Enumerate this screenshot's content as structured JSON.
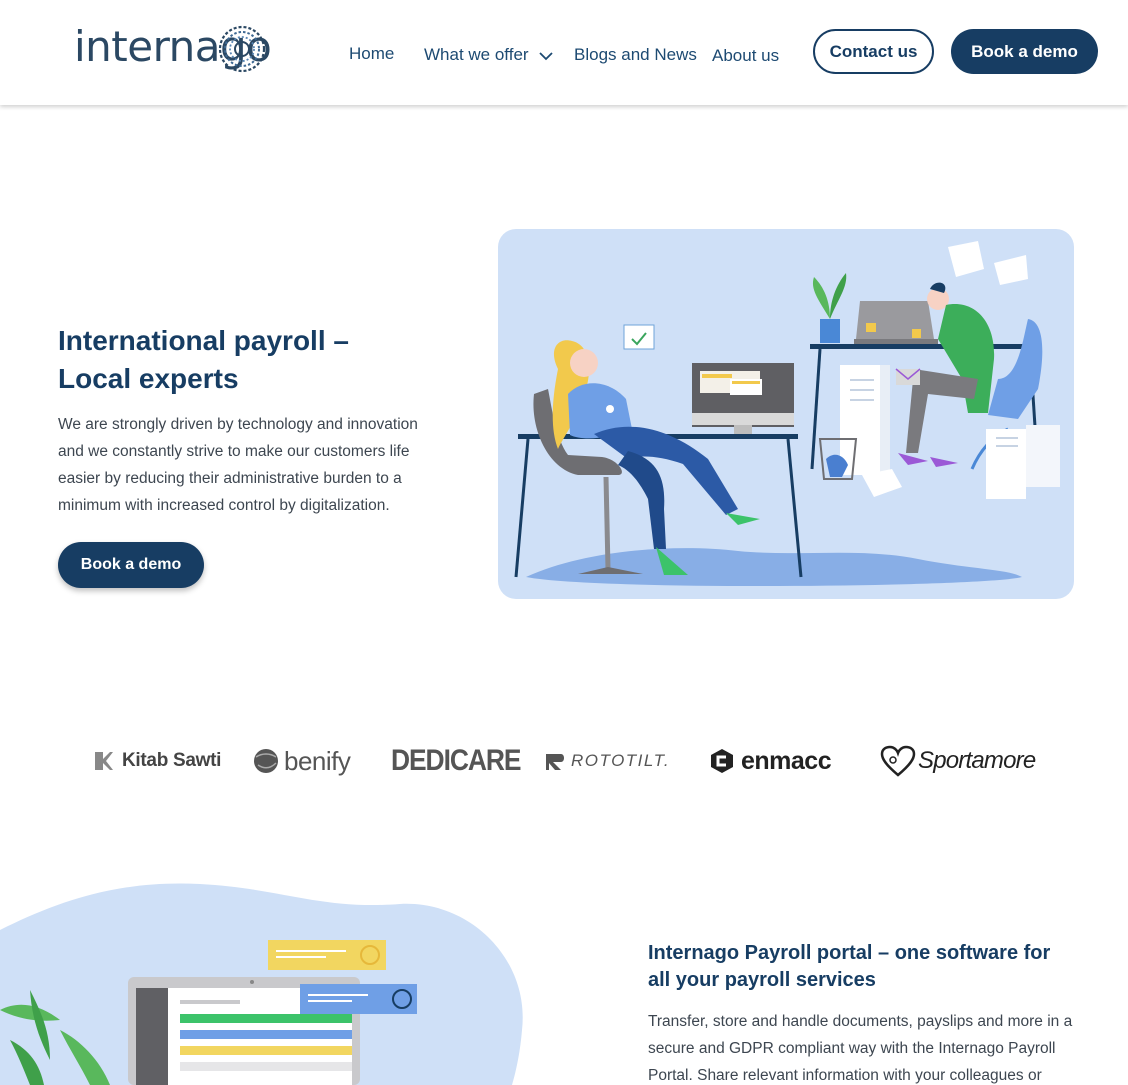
{
  "header": {
    "logo_text": "internago",
    "nav": [
      {
        "label": "Home"
      },
      {
        "label": "What we offer"
      },
      {
        "label": "Blogs and News"
      },
      {
        "label": "About us"
      }
    ],
    "contact_label": "Contact us",
    "demo_label": "Book a demo"
  },
  "hero": {
    "title": "International payroll – Local experts",
    "text": "We are strongly driven by technology and innovation and we constantly strive to make our customers life easier by reducing their administrative burden to a minimum with increased control by digitalization.",
    "button_label": "Book a demo"
  },
  "clients": [
    {
      "name": "Kitab Sawti"
    },
    {
      "name": "benify"
    },
    {
      "name": "DEDICARE"
    },
    {
      "name": "ROTOTILT."
    },
    {
      "name": "enmacc"
    },
    {
      "name": "Sportamore"
    }
  ],
  "portal": {
    "title": "Internago Payroll portal – one software for all your payroll services",
    "text": "Transfer, store and handle documents, payslips and more in a secure and GDPR compliant way with the Internago Payroll Portal. Share relevant information with your colleagues or"
  },
  "colors": {
    "primary": "#173d63",
    "nav_text": "#1d4a72",
    "illustration_bg": "#cfe0f7"
  }
}
